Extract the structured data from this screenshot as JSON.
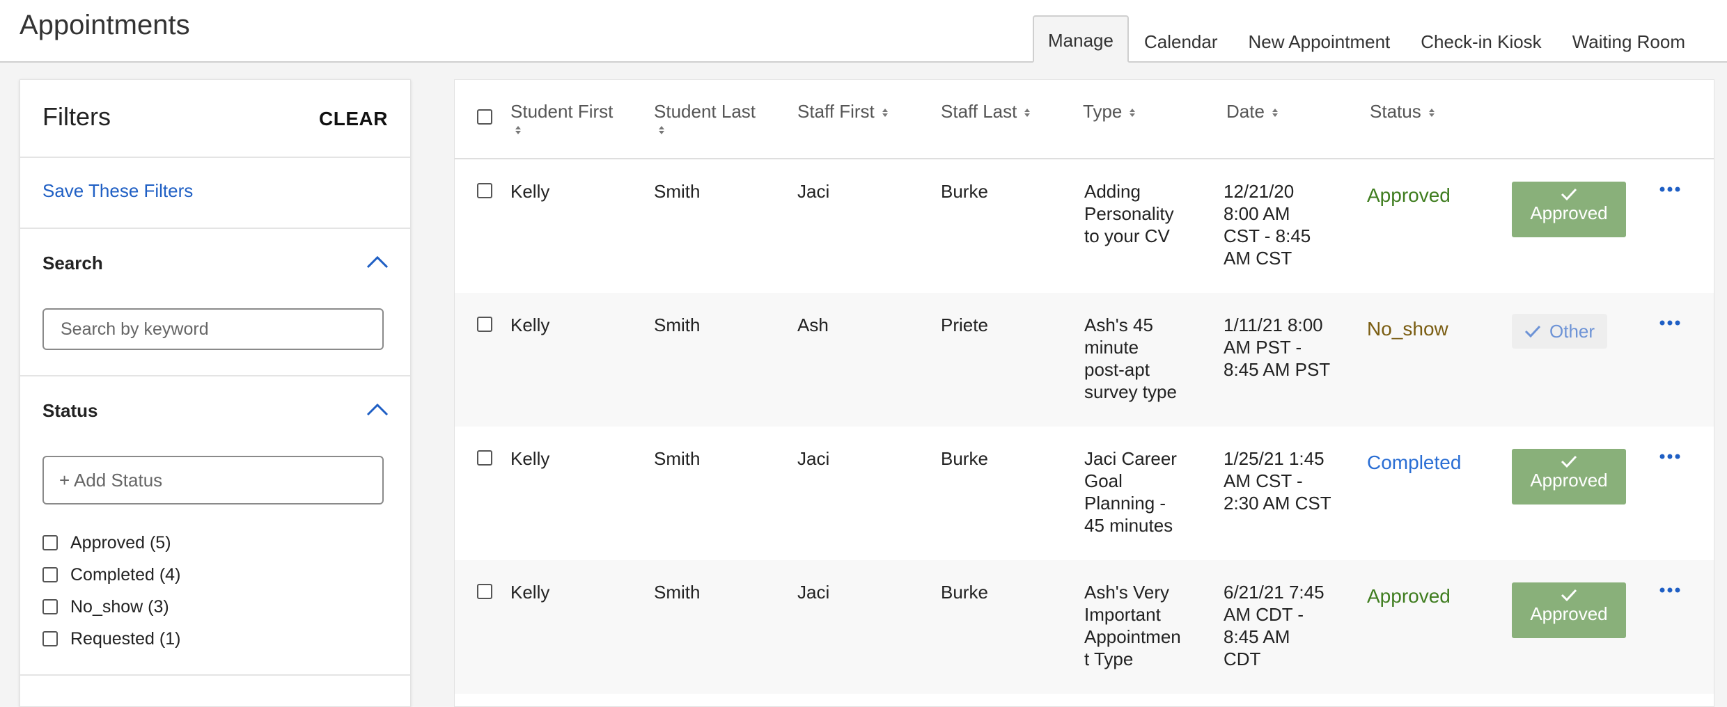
{
  "header": {
    "title": "Appointments"
  },
  "tabs": [
    {
      "label": "Manage",
      "active": true
    },
    {
      "label": "Calendar"
    },
    {
      "label": "New Appointment"
    },
    {
      "label": "Check-in Kiosk"
    },
    {
      "label": "Waiting Room"
    }
  ],
  "filters": {
    "title": "Filters",
    "clear_label": "CLEAR",
    "save_label": "Save These Filters",
    "search": {
      "title": "Search",
      "placeholder": "Search by keyword",
      "value": ""
    },
    "status": {
      "title": "Status",
      "add_label": "+ Add Status",
      "options": [
        "Approved (5)",
        "Completed (4)",
        "No_show (3)",
        "Requested (1)"
      ]
    }
  },
  "table": {
    "columns": [
      "Student First",
      "Student Last",
      "Staff First",
      "Staff Last",
      "Type",
      "Date",
      "Status"
    ],
    "rows": [
      {
        "student_first": "Kelly",
        "student_last": "Smith",
        "staff_first": "Jaci",
        "staff_last": "Burke",
        "type": [
          "Adding",
          "Personality",
          "to your CV"
        ],
        "date": [
          "12/21/20",
          "8:00 AM",
          "CST - 8:45",
          "AM CST"
        ],
        "status": "Approved",
        "action": "Approved"
      },
      {
        "student_first": "Kelly",
        "student_last": "Smith",
        "staff_first": "Ash",
        "staff_last": "Priete",
        "type": [
          "Ash's 45",
          "minute",
          "post-apt",
          "survey type"
        ],
        "date": [
          "1/11/21 8:00",
          "AM PST -",
          "8:45 AM PST"
        ],
        "status": "No_show",
        "action": "Other"
      },
      {
        "student_first": "Kelly",
        "student_last": "Smith",
        "staff_first": "Jaci",
        "staff_last": "Burke",
        "type": [
          "Jaci Career",
          "Goal",
          "Planning -",
          "45 minutes"
        ],
        "date": [
          "1/25/21 1:45",
          "AM CST -",
          "2:30 AM CST"
        ],
        "status": "Completed",
        "action": "Approved"
      },
      {
        "student_first": "Kelly",
        "student_last": "Smith",
        "staff_first": "Jaci",
        "staff_last": "Burke",
        "type": [
          "Ash's Very",
          "Important",
          "Appointmen",
          "t Type"
        ],
        "date": [
          "6/21/21 7:45",
          "AM CDT -",
          "8:45 AM",
          "CDT"
        ],
        "status": "Approved",
        "action": "Approved"
      }
    ]
  },
  "colors": {
    "approved_text": "#3f7d1f",
    "no_show_text": "#7a5d12",
    "completed_text": "#2a6ed4",
    "approved_button": "#89b07a",
    "link": "#1f5fc4"
  }
}
